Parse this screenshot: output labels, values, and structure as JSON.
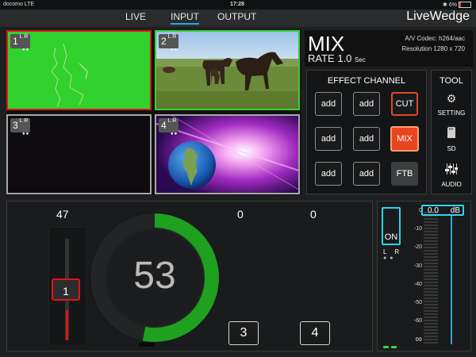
{
  "status_bar": {
    "carrier": "docomo",
    "network": "LTE",
    "time": "17:28",
    "battery": "6%"
  },
  "nav": {
    "tabs": [
      "LIVE",
      "INPUT",
      "OUTPUT"
    ],
    "active_tab": "INPUT",
    "brand": "LiveWedge"
  },
  "inputs": [
    {
      "number": "1",
      "lr": "L R",
      "content": "green screen",
      "state": "program"
    },
    {
      "number": "2",
      "lr": "L R",
      "content": "horses in field",
      "state": "preview"
    },
    {
      "number": "3",
      "lr": "L R",
      "content": "black",
      "state": "idle"
    },
    {
      "number": "4",
      "lr": "L R",
      "content": "globe graphic",
      "state": "idle"
    }
  ],
  "mix_panel": {
    "effect": "MIX",
    "rate_label": "RATE",
    "rate_value": "1.0",
    "rate_unit": "Sec",
    "codec": "A/V Codec:  h264/aac",
    "resolution": "Resolution  1280 x 720"
  },
  "effect_channel": {
    "title": "EFFECT CHANNEL",
    "buttons": [
      "add",
      "add",
      "CUT",
      "add",
      "add",
      "MIX",
      "add",
      "add",
      "FTB"
    ]
  },
  "tool": {
    "title": "TOOL",
    "items": [
      "SETTING",
      "SD",
      "AUDIO"
    ]
  },
  "control": {
    "left_value": "47",
    "dial_value": "53",
    "dial_fraction": 0.53,
    "value_3": "0",
    "value_4": "0",
    "fader_label": "1",
    "source_a": "3",
    "source_b": "4"
  },
  "audio": {
    "on_label": "ON",
    "lr_label": "L R",
    "db_value": "0.0",
    "db_unit": "dB",
    "scale": [
      "0",
      "-10",
      "-20",
      "-30",
      "-40",
      "-50",
      "-60",
      "∞"
    ]
  },
  "colors": {
    "accent": "#2aa9e0",
    "program": "#e01515",
    "preview": "#35d135",
    "mix_active": "#e8441e",
    "audio_accent": "#2ed3f0"
  }
}
